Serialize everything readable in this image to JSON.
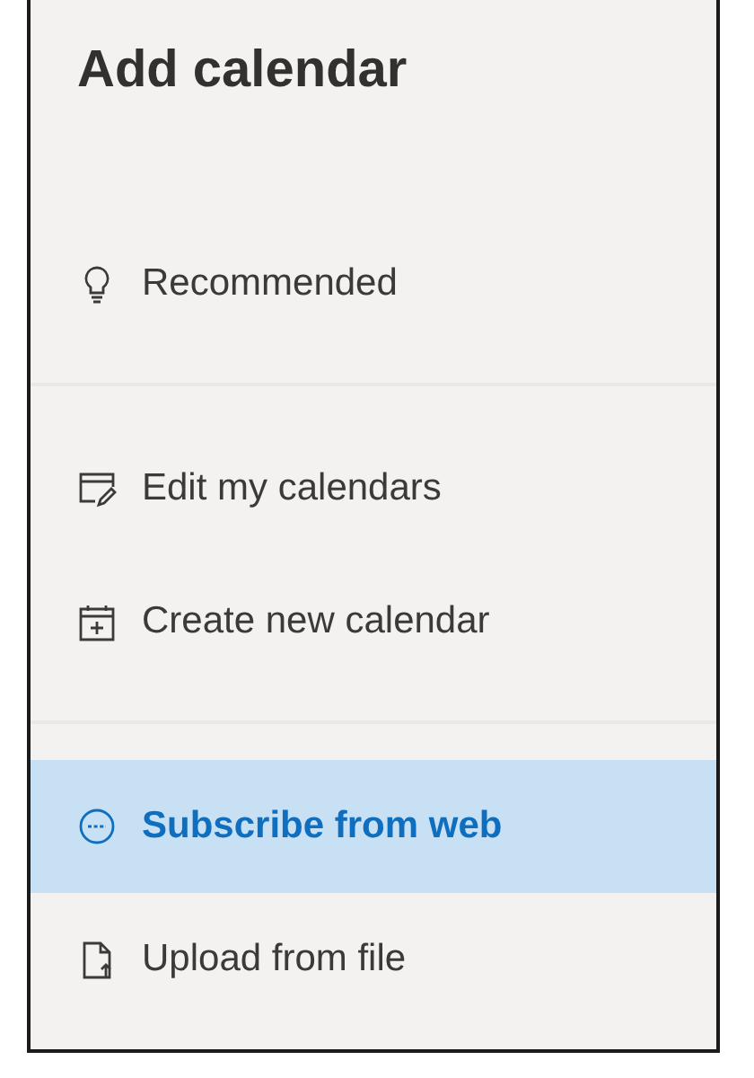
{
  "title": "Add calendar",
  "sections": [
    {
      "items": [
        {
          "kind": "recommended",
          "label": "Recommended",
          "selected": false
        }
      ]
    },
    {
      "items": [
        {
          "kind": "edit",
          "label": "Edit my calendars",
          "selected": false
        },
        {
          "kind": "create",
          "label": "Create new calendar",
          "selected": false
        }
      ]
    },
    {
      "items": [
        {
          "kind": "subscribe",
          "label": "Subscribe from web",
          "selected": true
        },
        {
          "kind": "upload",
          "label": "Upload from file",
          "selected": false
        }
      ]
    }
  ]
}
